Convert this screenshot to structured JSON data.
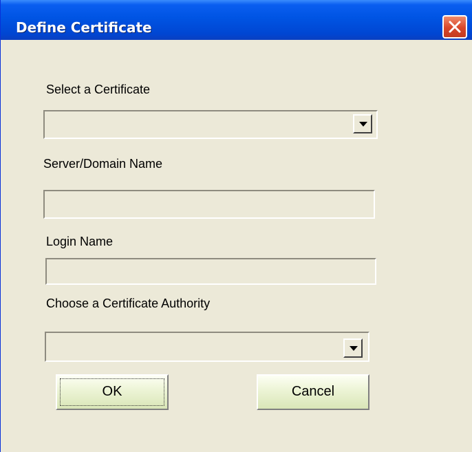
{
  "window": {
    "title": "Define Certificate"
  },
  "titlebar": {
    "close_icon": "close-icon"
  },
  "form": {
    "certificate_label": "Select a Certificate",
    "certificate_value": "",
    "server_label": "Server/Domain Name",
    "server_value": "",
    "login_label": "Login Name",
    "login_value": "",
    "authority_label": "Choose a Certificate Authority",
    "authority_value": ""
  },
  "buttons": {
    "ok_label": "OK",
    "cancel_label": "Cancel"
  },
  "colors": {
    "titlebar": "#0054e3",
    "window_bg": "#ece9d8",
    "close_button": "#d8462a",
    "button_face": "#eef5d8"
  }
}
